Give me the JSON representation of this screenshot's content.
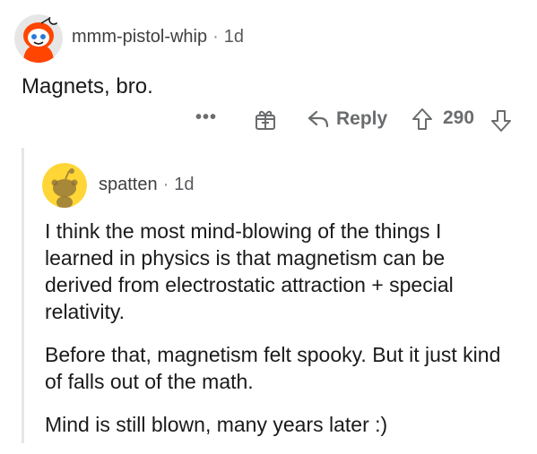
{
  "top_comment": {
    "username": "mmm-pistol-whip",
    "separator": "·",
    "age": "1d",
    "body": "Magnets, bro."
  },
  "actions": {
    "more": "•••",
    "reply_label": "Reply",
    "vote_count": "290"
  },
  "reply_comment": {
    "username": "spatten",
    "separator": "·",
    "age": "1d",
    "paragraphs": [
      "I think the most mind-blowing of the things I learned in physics is that magnetism can be derived from electrostatic attraction + special relativity.",
      "Before that, magnetism felt spooky. But it just kind of falls out of the math.",
      "Mind is still blown, many years later :)"
    ]
  },
  "colors": {
    "text_primary": "#1a1a1b",
    "text_muted": "#6a6c6e",
    "thread_line": "#e6e6e6",
    "avatar_top_bg": "#ff4500",
    "avatar_reply_bg": "#ffd635"
  },
  "icons": {
    "top_avatar": "snoo-avatar-icon",
    "reply_avatar": "snoo-avatar-icon",
    "award": "gift-icon",
    "reply": "reply-arrow-icon",
    "upvote": "upvote-arrow-icon",
    "downvote": "downvote-arrow-icon"
  }
}
